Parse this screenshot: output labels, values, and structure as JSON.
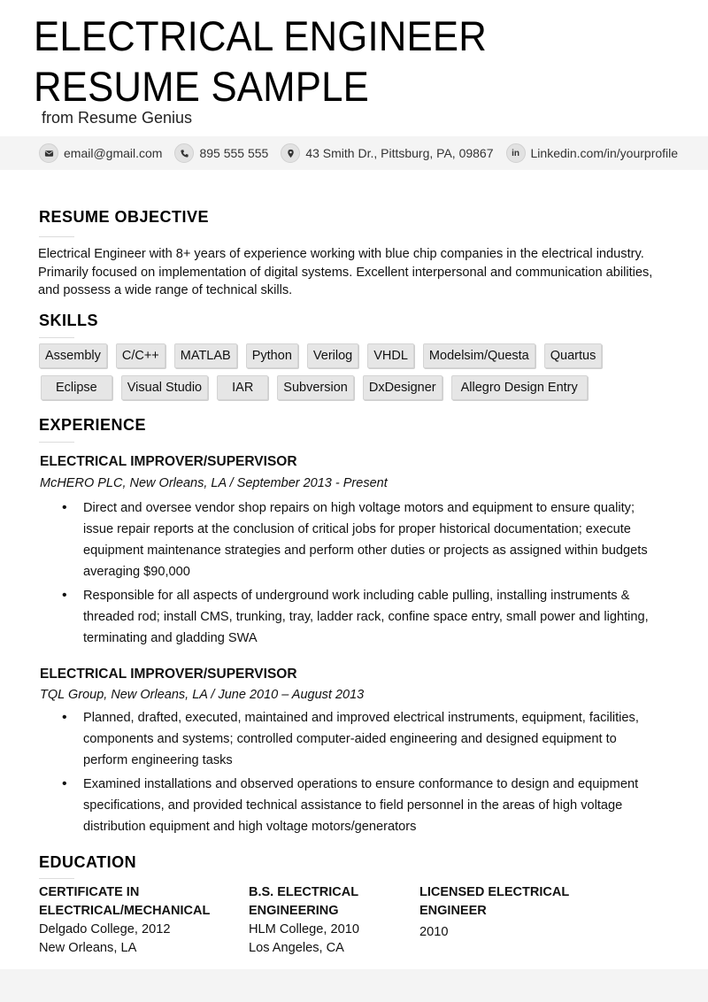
{
  "header": {
    "title": "ELECTRICAL ENGINEER RESUME SAMPLE",
    "subtitle": "from Resume Genius"
  },
  "contact": [
    {
      "icon": "email-icon",
      "text": "email@gmail.com"
    },
    {
      "icon": "phone-icon",
      "text": "895 555 555"
    },
    {
      "icon": "location-pin-icon",
      "text": "43 Smith Dr., Pittsburg, PA, 09867"
    },
    {
      "icon": "linkedin-icon",
      "text": "Linkedin.com/in/yourprofile",
      "glyph": "in"
    }
  ],
  "objective": {
    "heading": "RESUME OBJECTIVE",
    "text": "Electrical Engineer with 8+ years of experience working with blue chip companies in the electrical industry. Primarily focused on implementation of digital systems. Excellent interpersonal and communication abilities, and possess a wide range of technical skills."
  },
  "skills": {
    "heading": "SKILLS",
    "rows": [
      [
        "Assembly",
        "C/C++",
        "MATLAB",
        "Python",
        "Verilog",
        "VHDL",
        "Modelsim/Questa",
        "Quartus"
      ],
      [
        "Eclipse",
        "Visual Studio",
        "IAR",
        "Subversion",
        "DxDesigner",
        "Allegro Design Entry"
      ]
    ]
  },
  "experience": {
    "heading": "EXPERIENCE",
    "jobs": [
      {
        "title": "ELECTRICAL IMPROVER/SUPERVISOR",
        "meta": "McHERO PLC, New Orleans, LA  /  September 2013 - Present",
        "bullets": [
          "Direct and oversee vendor shop repairs on high voltage motors and equipment to ensure quality; issue repair reports at the conclusion of critical jobs for proper historical documentation; execute equipment maintenance strategies and perform other duties or projects as assigned within budgets averaging $90,000",
          "Responsible for all aspects of underground work including cable pulling, installing instruments & threaded rod; install CMS, trunking, tray, ladder rack, confine space entry, small power and lighting, terminating and gladding SWA"
        ]
      },
      {
        "title": "ELECTRICAL IMPROVER/SUPERVISOR",
        "meta": "TQL Group, New Orleans, LA  /  June 2010 – August 2013",
        "bullets": [
          "Planned, drafted, executed, maintained and improved electrical instruments, equipment, facilities, components and systems; controlled computer-aided engineering and designed equipment to perform engineering tasks",
          "Examined installations and observed operations to ensure conformance to design and equipment specifications, and provided technical assistance to field personnel in the areas of high voltage distribution equipment and high voltage motors/generators"
        ]
      }
    ]
  },
  "education": {
    "heading": "EDUCATION",
    "entries": [
      {
        "degree": "CERTIFICATE IN ELECTRICAL/MECHANICAL",
        "school": "Delgado College, 2012",
        "location": "New Orleans, LA"
      },
      {
        "degree": "B.S. ELECTRICAL ENGINEERING",
        "school": "HLM College, 2010",
        "location": "Los Angeles, CA"
      },
      {
        "degree": "LICENSED ELECTRICAL ENGINEER",
        "school": "2010",
        "location": ""
      }
    ]
  }
}
